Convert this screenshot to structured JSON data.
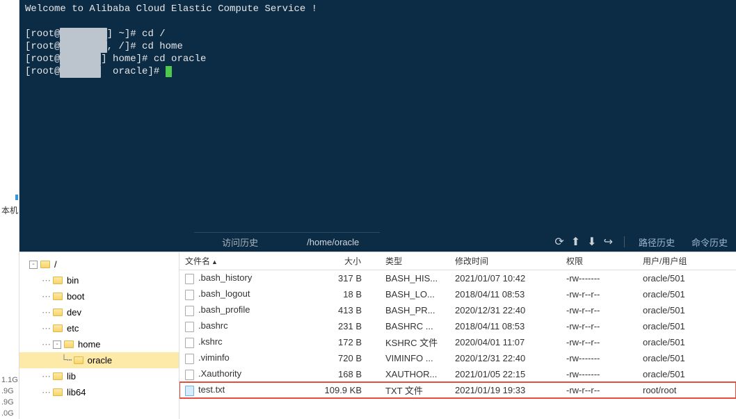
{
  "sidebar": {
    "label": "本机",
    "stats": [
      "1.1G",
      ".9G",
      ".9G",
      ".0G"
    ]
  },
  "terminal": {
    "lines": [
      {
        "text": "Welcome to Alibaba Cloud Elastic Compute Service !"
      },
      {
        "text": ""
      },
      {
        "prefix": "[root@",
        "blur": "        ",
        "suffix": "] ~]# cd /"
      },
      {
        "prefix": "[root@",
        "blur": "        ",
        "suffix": ", /]# cd home"
      },
      {
        "prefix": "[root@",
        "blur": "       ",
        "suffix": "] home]# cd oracle"
      },
      {
        "prefix": "[root@",
        "blur": "       ",
        "suffix": "  oracle]# ",
        "cursor": true
      }
    ]
  },
  "path_bar": {
    "tab1": "访问历史",
    "path": "/home/oracle",
    "link_history": "路径历史",
    "link_cmd": "命令历史"
  },
  "tree": [
    {
      "level": 0,
      "toggle": "-",
      "label": "/"
    },
    {
      "level": 1,
      "label": "bin"
    },
    {
      "level": 1,
      "label": "boot"
    },
    {
      "level": 1,
      "label": "dev"
    },
    {
      "level": 1,
      "label": "etc"
    },
    {
      "level": 1,
      "toggle": "-",
      "label": "home"
    },
    {
      "level": 2,
      "label": "oracle",
      "selected": true
    },
    {
      "level": 1,
      "label": "lib"
    },
    {
      "level": 1,
      "label": "lib64"
    }
  ],
  "list_headers": {
    "name": "文件名",
    "size": "大小",
    "type": "类型",
    "mtime": "修改时间",
    "perm": "权限",
    "owner": "用户/用户组"
  },
  "files": [
    {
      "name": ".bash_history",
      "size": "317 B",
      "type": "BASH_HIS...",
      "mtime": "2021/01/07 10:42",
      "perm": "-rw-------",
      "owner": "oracle/501"
    },
    {
      "name": ".bash_logout",
      "size": "18 B",
      "type": "BASH_LO...",
      "mtime": "2018/04/11 08:53",
      "perm": "-rw-r--r--",
      "owner": "oracle/501"
    },
    {
      "name": ".bash_profile",
      "size": "413 B",
      "type": "BASH_PR...",
      "mtime": "2020/12/31 22:40",
      "perm": "-rw-r--r--",
      "owner": "oracle/501"
    },
    {
      "name": ".bashrc",
      "size": "231 B",
      "type": "BASHRC ...",
      "mtime": "2018/04/11 08:53",
      "perm": "-rw-r--r--",
      "owner": "oracle/501"
    },
    {
      "name": ".kshrc",
      "size": "172 B",
      "type": "KSHRC 文件",
      "mtime": "2020/04/01 11:07",
      "perm": "-rw-r--r--",
      "owner": "oracle/501"
    },
    {
      "name": ".viminfo",
      "size": "720 B",
      "type": "VIMINFO ...",
      "mtime": "2020/12/31 22:40",
      "perm": "-rw-------",
      "owner": "oracle/501"
    },
    {
      "name": ".Xauthority",
      "size": "168 B",
      "type": "XAUTHOR...",
      "mtime": "2021/01/05 22:15",
      "perm": "-rw-------",
      "owner": "oracle/501"
    },
    {
      "name": "test.txt",
      "size": "109.9 KB",
      "type": "TXT 文件",
      "mtime": "2021/01/19 19:33",
      "perm": "-rw-r--r--",
      "owner": "root/root",
      "highlight": true,
      "txt": true
    }
  ]
}
